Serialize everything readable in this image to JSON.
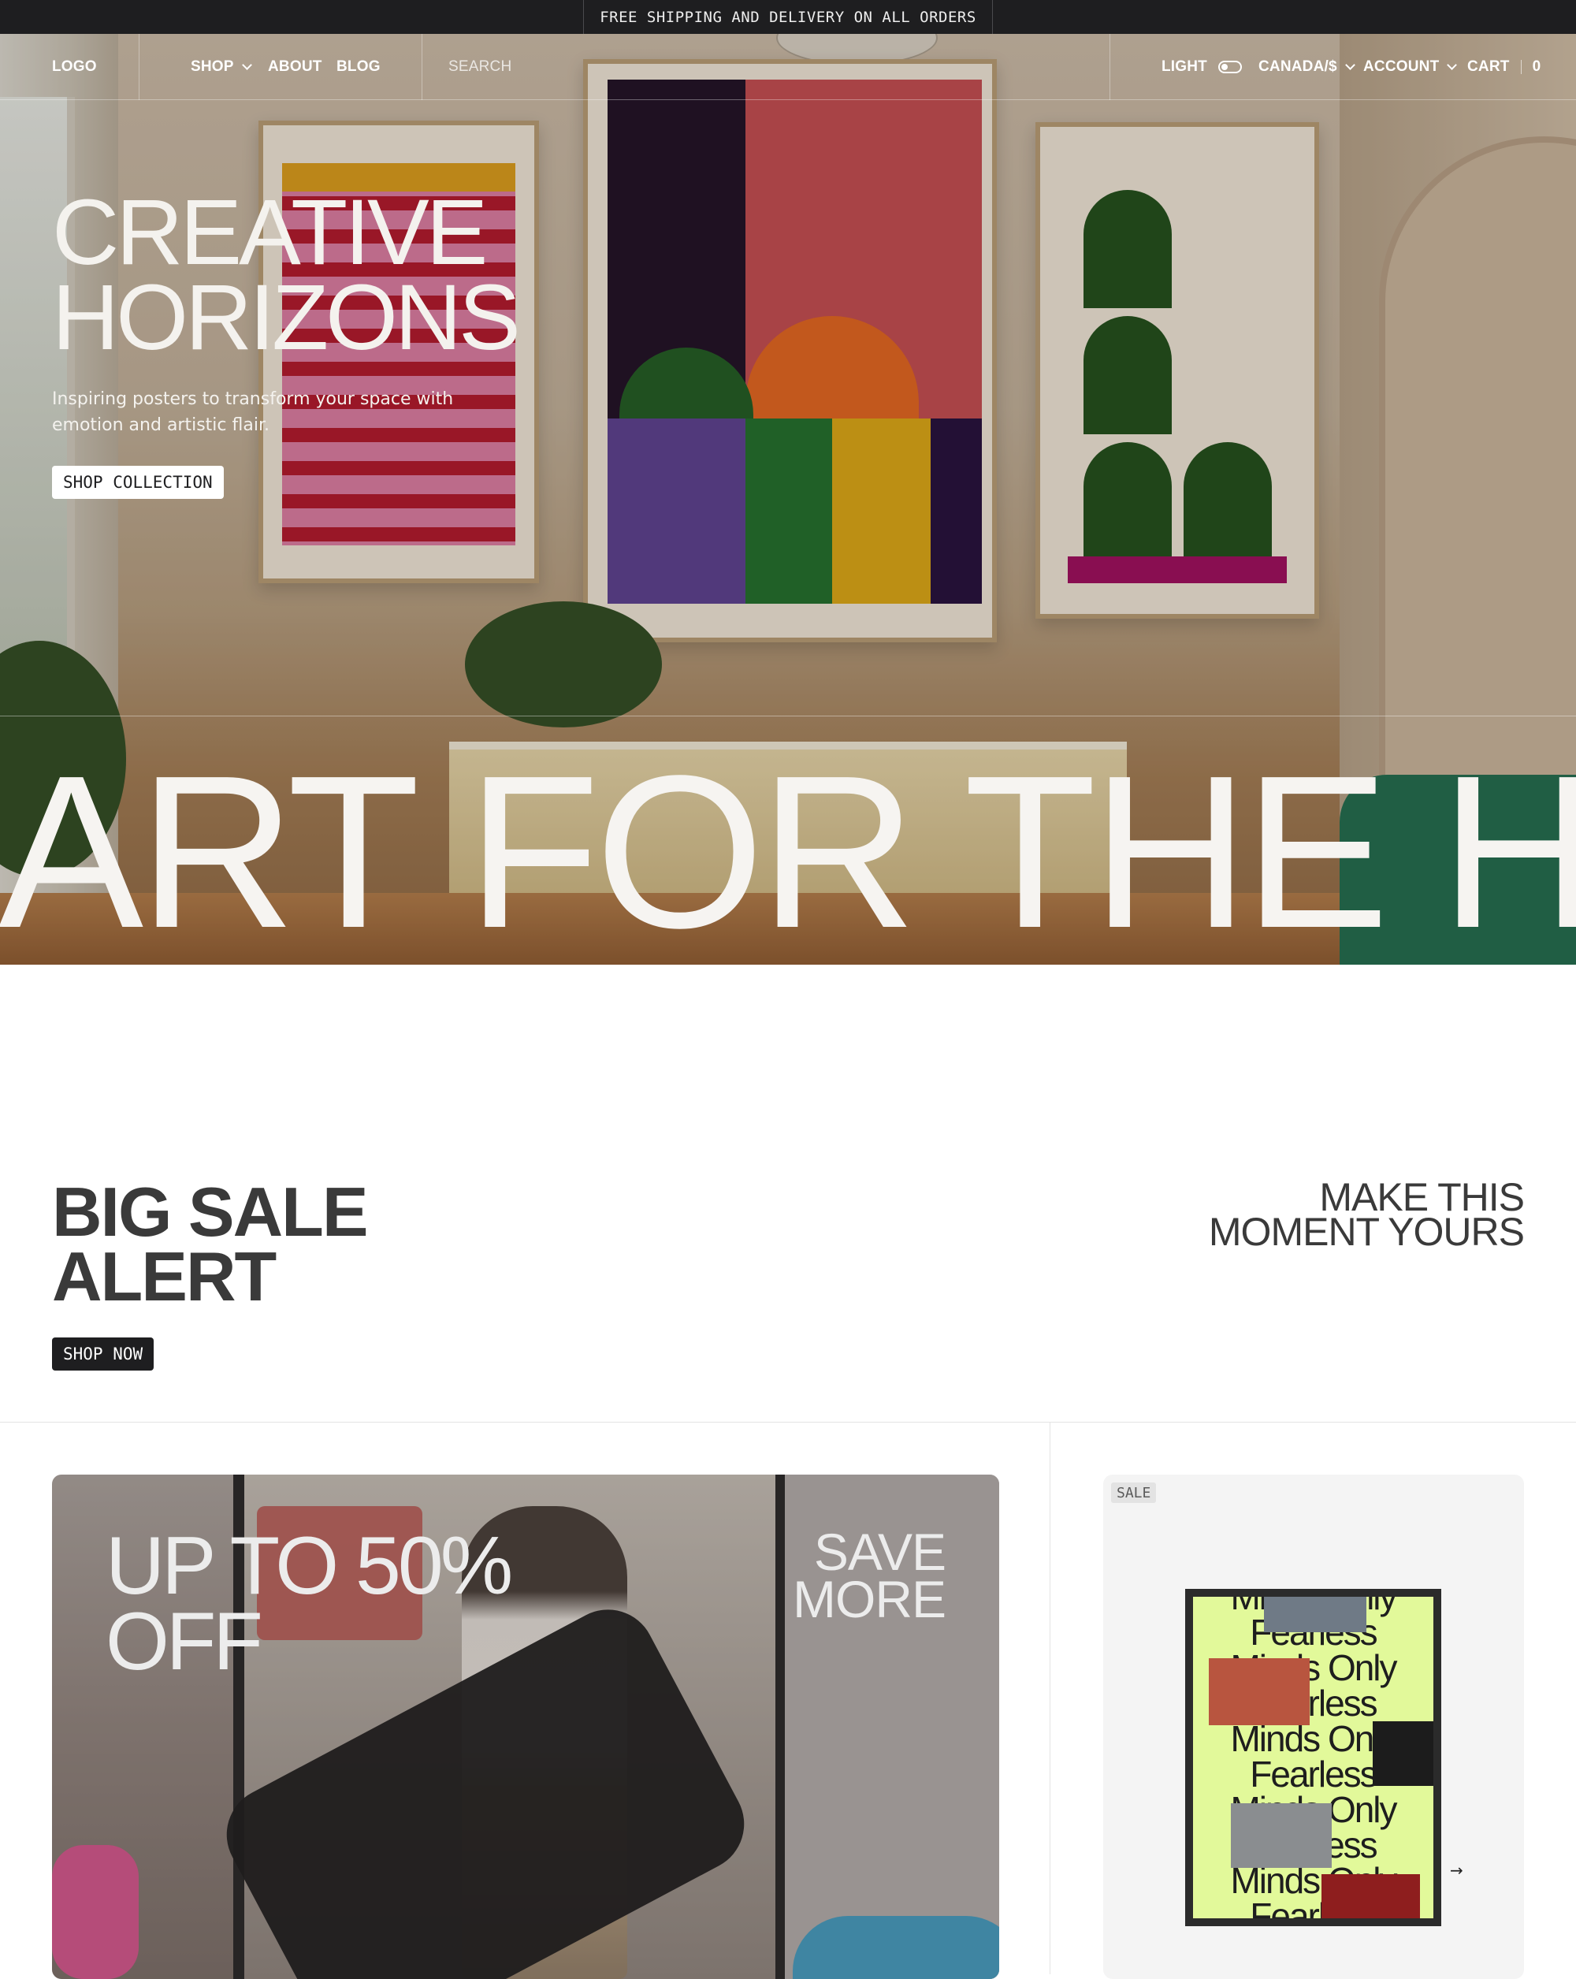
{
  "announcement": {
    "text": "FREE SHIPPING AND DELIVERY ON ALL ORDERS"
  },
  "nav": {
    "logo": "LOGO",
    "links": [
      {
        "label": "SHOP",
        "has_dropdown": true
      },
      {
        "label": "ABOUT",
        "has_dropdown": false
      },
      {
        "label": "BLOG",
        "has_dropdown": false
      }
    ],
    "search_placeholder": "SEARCH",
    "theme_label": "LIGHT",
    "locale": "CANADA/$",
    "account": "ACCOUNT",
    "cart_label": "CART",
    "cart_count": "0"
  },
  "hero": {
    "title_line1": "CREATIVE",
    "title_line2": "HORIZONS",
    "subtitle": "Inspiring posters to transform your space with emotion and artistic flair.",
    "cta": "SHOP COLLECTION",
    "marquee": "ART FOR THE HEA"
  },
  "sale": {
    "title_line1": "BIG SALE",
    "title_line2": "ALERT",
    "cta": "SHOP NOW",
    "tagline_line1": "MAKE THIS",
    "tagline_line2": "MOMENT YOURS"
  },
  "promo": {
    "title_line1": "UP TO 50%",
    "title_line2": "OFF",
    "side_line1": "SAVE",
    "side_line2": "MORE"
  },
  "product_card": {
    "badge": "SALE",
    "poster_lines": [
      "Minds Only",
      "Fearless",
      "Minds Only",
      "Fearless",
      "Minds Only",
      "Fearless",
      "Minds Only",
      "Fearless",
      "Minds Only",
      "Fearless"
    ],
    "nav_icon": "arrow-right-icon"
  },
  "colors": {
    "announcement_bg": "#1e1e20",
    "dark_button_bg": "#1e1e20",
    "poster_bg": "#e2f99a",
    "card_bg": "#f4f4f4"
  }
}
